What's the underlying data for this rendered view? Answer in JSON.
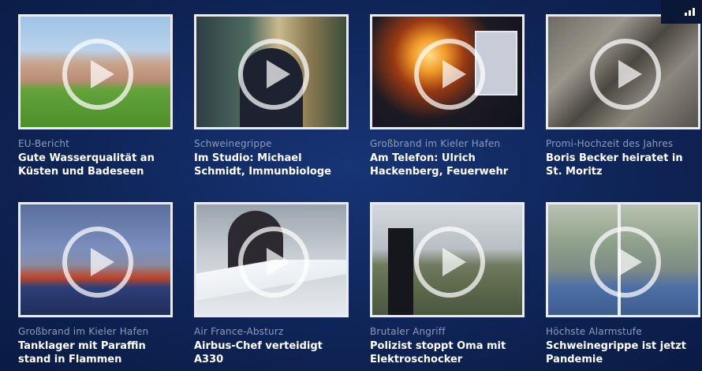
{
  "videos": [
    {
      "category": "EU-Bericht",
      "title_lines": [
        "Gute Wasserqualität an",
        "Küsten und Badeseen"
      ]
    },
    {
      "category": "Schweinegrippe",
      "title_lines": [
        "Im Studio: Michael",
        "Schmidt, Immunbiologe"
      ]
    },
    {
      "category": "Großbrand im Kieler Hafen",
      "title_lines": [
        "Am Telefon: Ulrich",
        "Hackenberg, Feuerwehr"
      ]
    },
    {
      "category": "Promi-Hochzeit des Jahres",
      "title_lines": [
        "Boris Becker heiratet in",
        "St. Moritz"
      ]
    },
    {
      "category": "Großbrand im Kieler Hafen",
      "title_lines": [
        "Tanklager mit Paraffin",
        "stand in Flammen"
      ]
    },
    {
      "category": "Air France-Absturz",
      "title_lines": [
        "Airbus-Chef verteidigt",
        "A330"
      ]
    },
    {
      "category": "Brutaler Angriff",
      "title_lines": [
        "Polizist stoppt Oma mit",
        "Elektroschocker"
      ]
    },
    {
      "category": "Höchste Alarmstufe",
      "title_lines": [
        "Schweinegrippe ist jetzt",
        "Pandemie"
      ]
    }
  ],
  "colors": {
    "background": "#0f2558",
    "category_text": "#8f9bb8",
    "title_text": "#ffffff",
    "thumb_border": "#e8ecf2"
  },
  "icons": {
    "play": "play-icon",
    "corner": "signal-bars-icon"
  }
}
